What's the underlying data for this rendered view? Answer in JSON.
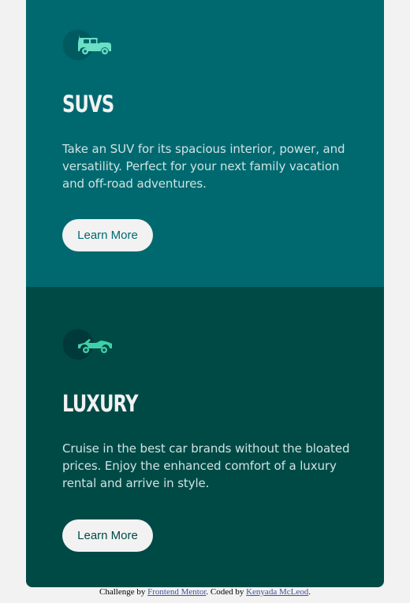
{
  "cards": [
    {
      "title": "SUVs",
      "icon": "suv-icon",
      "text": "Take an SUV for its spacious interior, power, and versatility. Perfect for your next family vacation and off-road adventures.",
      "button": "Learn More",
      "bg_color": "#006970"
    },
    {
      "title": "Luxury",
      "icon": "luxury-car-icon",
      "text": "Cruise in the best car brands without the bloated prices. Enjoy the enhanced comfort of a luxury rental and arrive in style.",
      "button": "Learn More",
      "bg_color": "#004a46"
    }
  ],
  "attribution": {
    "prefix": "Challenge by ",
    "mentor_link": "Frontend Mentor",
    "middle": ". Coded by ",
    "author_link": "Kenyada McLeod",
    "suffix": "."
  },
  "colors": {
    "page_bg": "#f2f2f2",
    "icon_green": "#3fd0a8",
    "button_bg": "#f2f2f2",
    "link": "#3e52a3"
  }
}
